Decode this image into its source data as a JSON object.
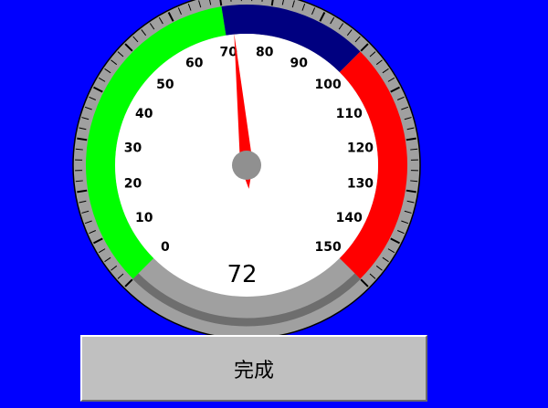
{
  "gauge": {
    "min": 0,
    "max": 150,
    "value": 72,
    "value_text": "72",
    "major_step": 10,
    "minor_step": 2,
    "tick_labels": [
      "0",
      "10",
      "20",
      "30",
      "40",
      "50",
      "60",
      "70",
      "80",
      "90",
      "100",
      "110",
      "120",
      "130",
      "140",
      "150"
    ],
    "zones": [
      {
        "from": 0,
        "to": 70,
        "color": "#00ff00"
      },
      {
        "from": 70,
        "to": 100,
        "color": "#000080"
      },
      {
        "from": 100,
        "to": 150,
        "color": "#ff0000"
      }
    ],
    "colors": {
      "background": "#0000ff",
      "bezel": "#a0a0a0",
      "bezel_shadow": "#6e6e6e",
      "face": "#ffffff",
      "needle": "#ff0000",
      "hub": "#909090",
      "tick": "#000000"
    }
  },
  "button": {
    "label": "完成"
  }
}
